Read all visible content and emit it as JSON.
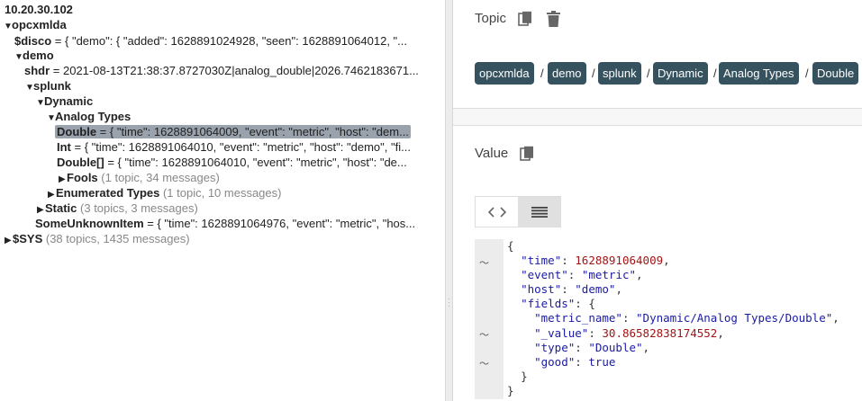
{
  "tree": {
    "broker": "10.20.30.102",
    "opcxmlda": "opcxmlda",
    "disco_key": "$disco",
    "disco_val": " = { \"demo\": { \"added\": 1628891024928, \"seen\": 1628891064012, \"...",
    "demo": "demo",
    "shdr_key": "shdr",
    "shdr_val": " = 2021-08-13T21:38:37.8727030Z|analog_double|2026.7462183671...",
    "splunk": "splunk",
    "dynamic": "Dynamic",
    "analog_types": "Analog Types",
    "double_key": "Double",
    "double_val": " = { \"time\": 1628891064009, \"event\": \"metric\", \"host\": \"dem...",
    "int_key": "Int",
    "int_val": " = { \"time\": 1628891064010, \"event\": \"metric\", \"host\": \"demo\", \"fi...",
    "doublearr_key": "Double[]",
    "doublearr_val": " = { \"time\": 1628891064010, \"event\": \"metric\", \"host\": \"de...",
    "fools": "Fools",
    "fools_meta": " (1 topic, 34 messages)",
    "enum": "Enumerated Types",
    "enum_meta": " (1 topic, 10 messages)",
    "static": "Static",
    "static_meta": " (3 topics, 3 messages)",
    "unknown_key": "SomeUnknownItem",
    "unknown_val": " = { \"time\": 1628891064976, \"event\": \"metric\", \"hos...",
    "sys": "$SYS",
    "sys_meta": " (38 topics, 1435 messages)"
  },
  "topic": {
    "title": "Topic",
    "breadcrumb": [
      "opcxmlda",
      "demo",
      "splunk",
      "Dynamic",
      "Analog Types",
      "Double"
    ],
    "separator": "/"
  },
  "value": {
    "title": "Value",
    "json_lines": {
      "l1": "{",
      "time_k": "\"time\"",
      "time_v": "1628891064009",
      "event_k": "\"event\"",
      "event_v": "\"metric\"",
      "host_k": "\"host\"",
      "host_v": "\"demo\"",
      "fields_k": "\"fields\"",
      "metric_k": "\"metric_name\"",
      "metric_v": "\"Dynamic/Analog Types/Double\"",
      "value_k": "\"_value\"",
      "value_v": "30.86582838174552",
      "type_k": "\"type\"",
      "type_v": "\"Double\"",
      "good_k": "\"good\"",
      "good_v": "true",
      "close_inner": "}",
      "close_outer": "}"
    }
  },
  "colors": {
    "chip_bg": "#37525f",
    "selection": "#9aa3ad"
  }
}
